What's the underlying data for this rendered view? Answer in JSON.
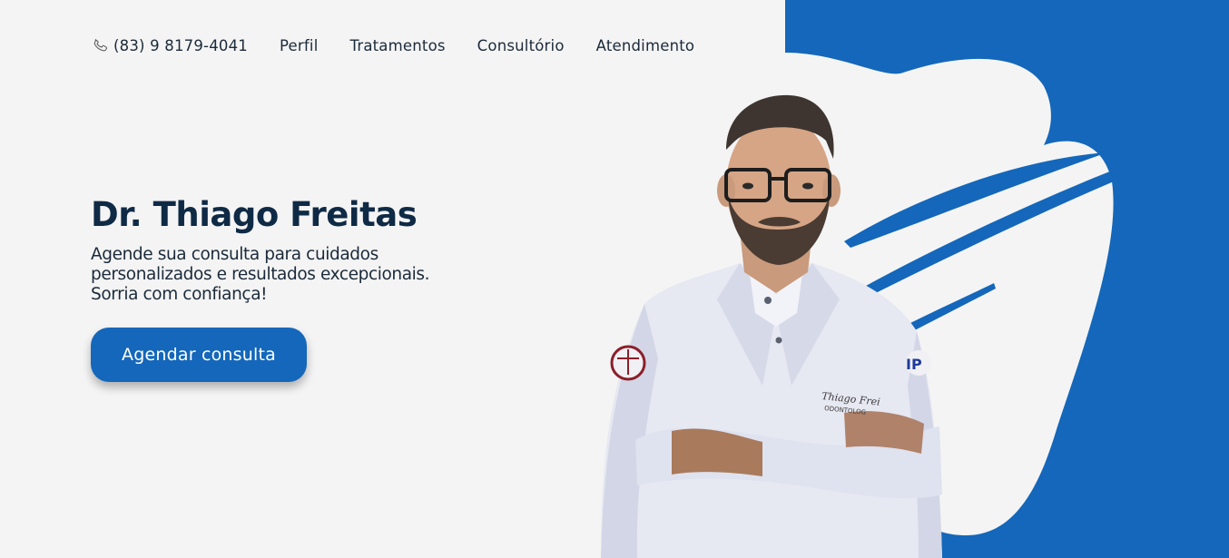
{
  "nav": {
    "phone": "(83) 9 8179-4041",
    "items": [
      {
        "label": "Perfil"
      },
      {
        "label": "Tratamentos"
      },
      {
        "label": "Consultório"
      },
      {
        "label": "Atendimento"
      }
    ]
  },
  "hero": {
    "title": "Dr. Thiago Freitas",
    "subtitle": "Agende sua consulta para cuidados personalizados e resultados excepcionais. Sorria com confiança!",
    "cta_label": "Agendar consulta"
  },
  "doctor": {
    "coat_embroidery_name": "Thiago Frei",
    "coat_embroidery_dept": "ODONTOLOG"
  },
  "colors": {
    "brand_blue": "#1467ba",
    "title_navy": "#0f2a45",
    "background": "#f4f4f4"
  },
  "icons": {
    "phone": "phone-icon"
  }
}
